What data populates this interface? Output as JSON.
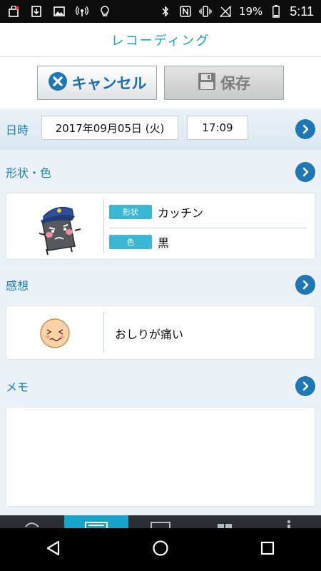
{
  "status_bar": {
    "battery": "19%",
    "time": "5:11",
    "left_icons": [
      "shopping-bag-icon",
      "download-icon",
      "image-icon",
      "hotspot-icon",
      "lightbulb-icon"
    ],
    "right_icons": [
      "bluetooth-icon",
      "nfc-icon",
      "vibrate-icon",
      "no-signal-icon",
      "battery-icon"
    ]
  },
  "header": {
    "title": "レコーディング"
  },
  "actions": {
    "cancel_label": "キャンセル",
    "save_label": "保存"
  },
  "datetime": {
    "label": "日時",
    "date": "2017年09月05日 (火)",
    "time": "17:09"
  },
  "shape_color": {
    "label": "形状・色",
    "shape_tag": "形状",
    "shape_value": "カッチン",
    "color_tag": "色",
    "color_value": "黒"
  },
  "feeling": {
    "label": "感想",
    "value": "おしりが痛い"
  },
  "memo": {
    "label": "メモ",
    "value": ""
  },
  "colors": {
    "accent": "#1aa3c9",
    "button_blue": "#1f77b4",
    "tag": "#3ab8d3"
  },
  "bottom_tabs": [
    "signal-tab",
    "record-tab",
    "calendar-tab",
    "grid-tab",
    "more-tab"
  ],
  "active_tab": 1,
  "nav_buttons": [
    "back-button",
    "home-button",
    "recents-button"
  ]
}
